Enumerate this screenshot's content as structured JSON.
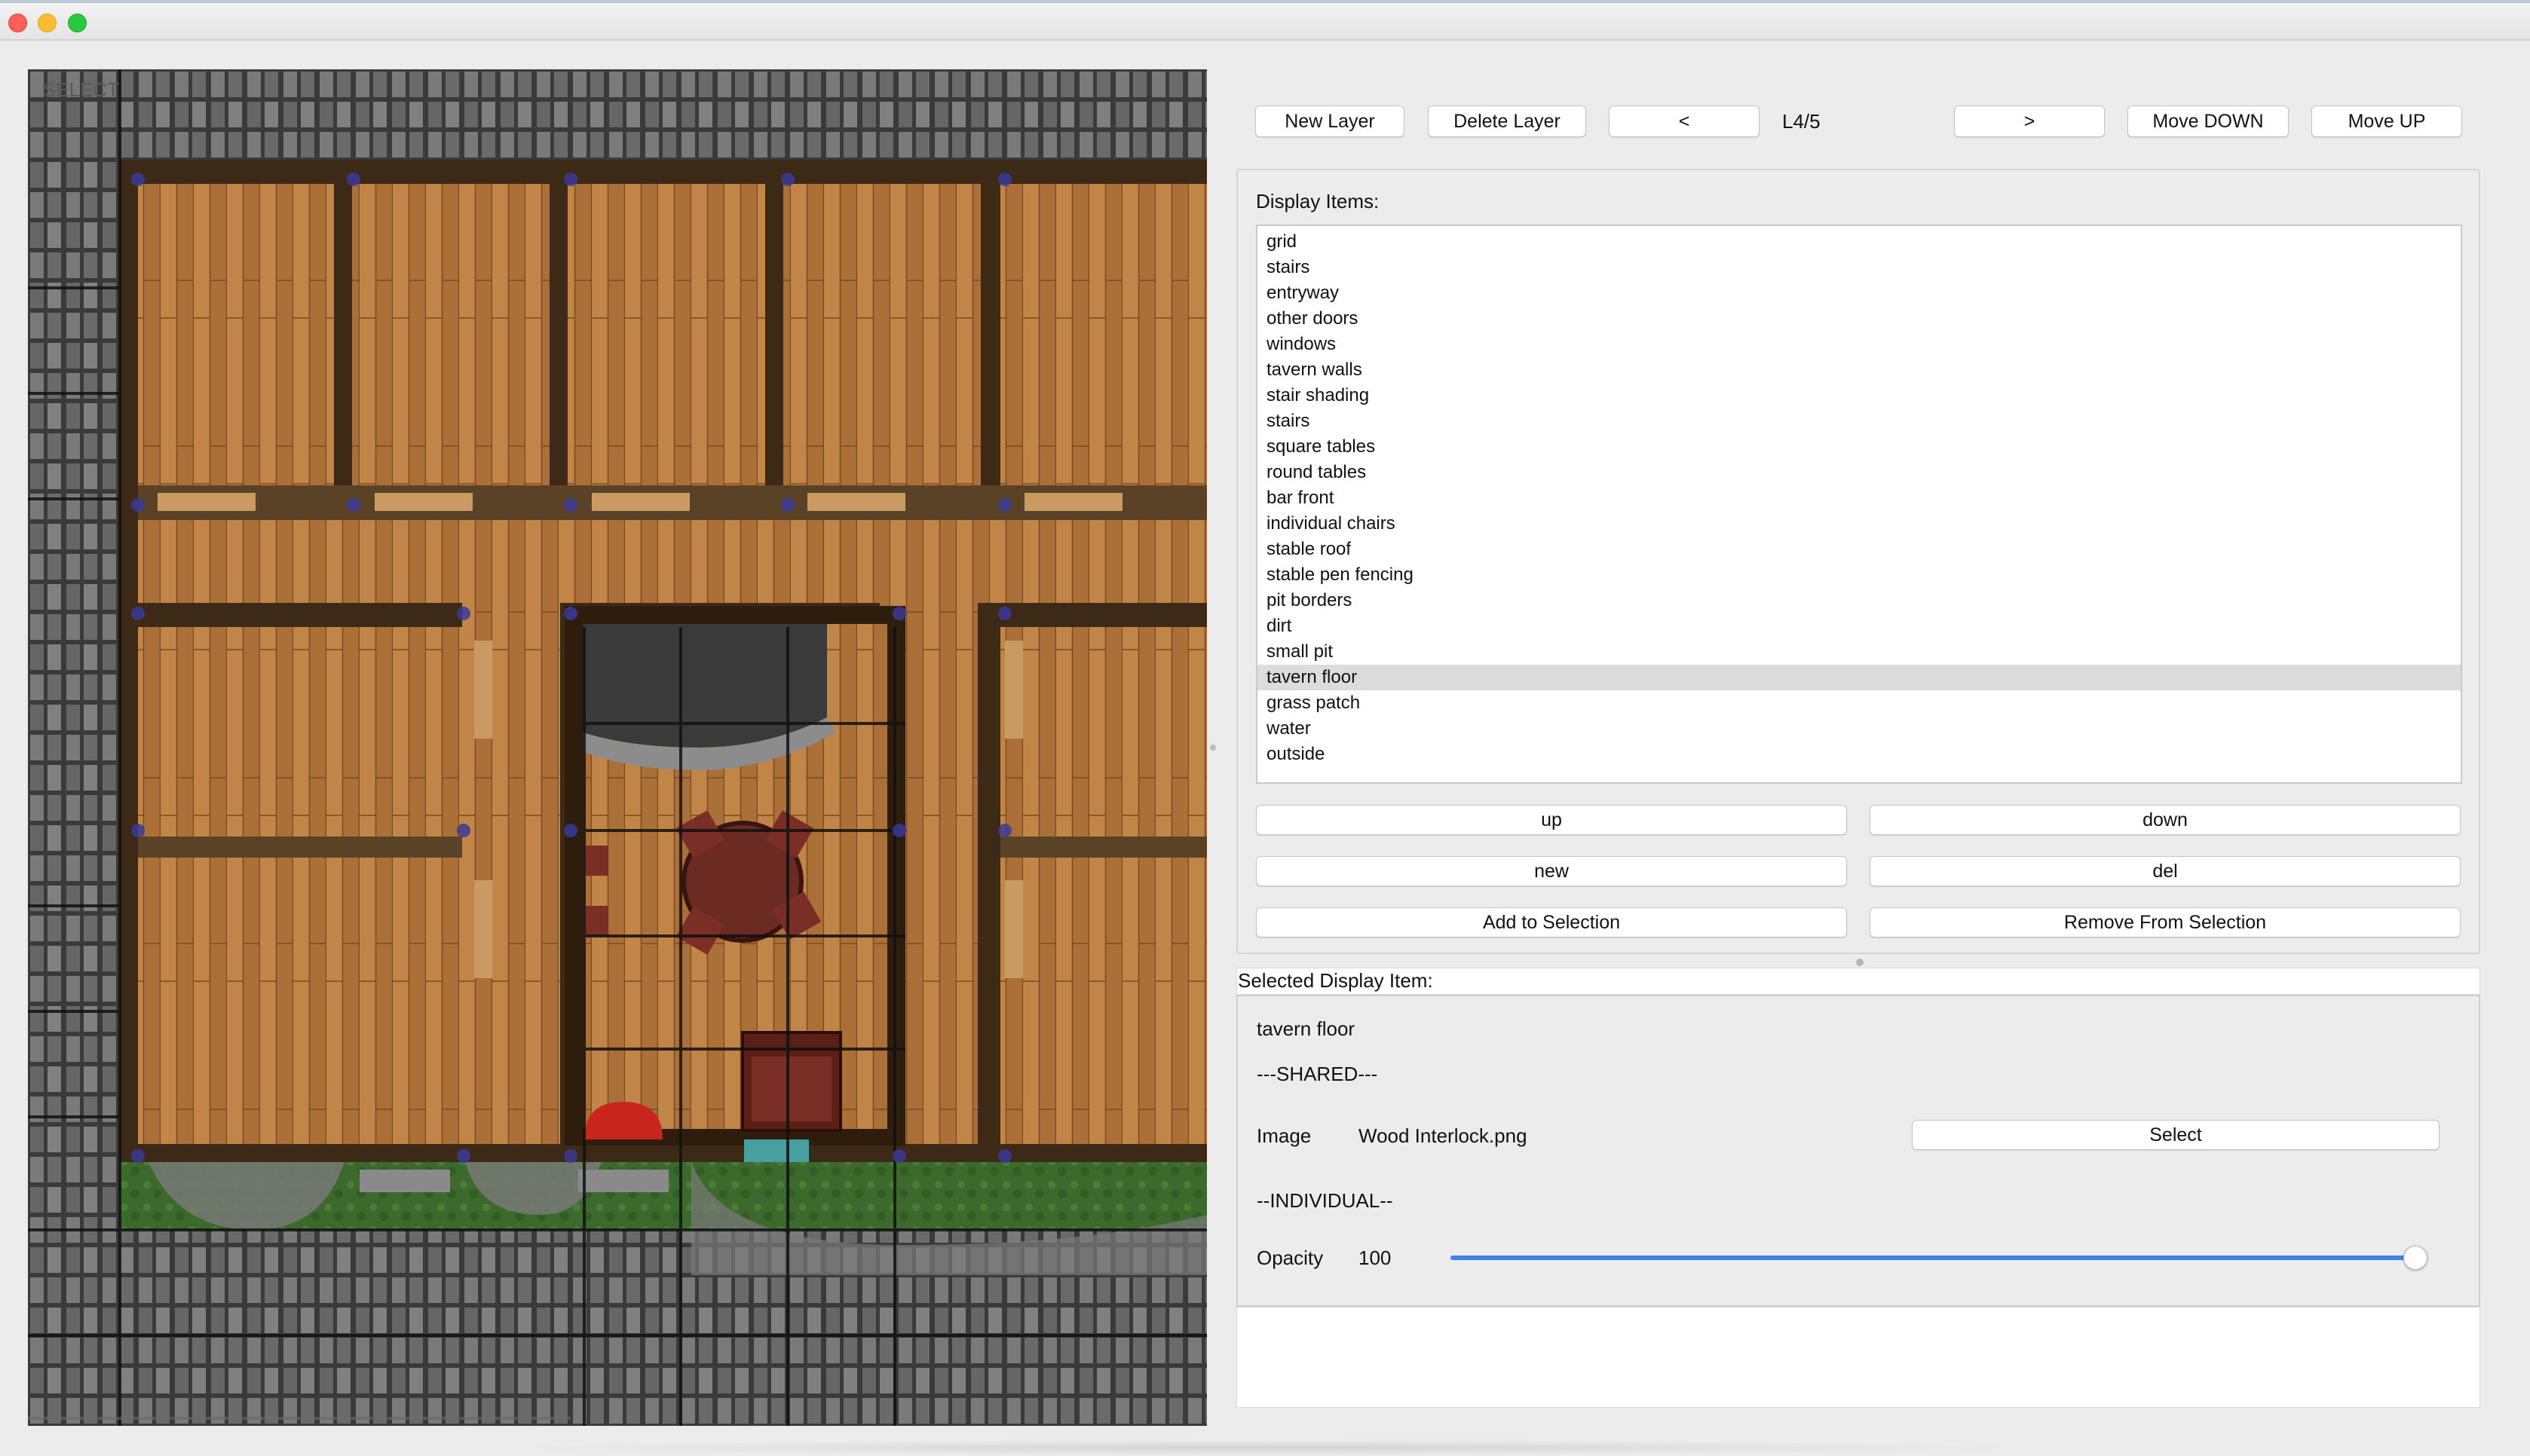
{
  "window": {
    "controls": [
      "close",
      "minimize",
      "zoom"
    ]
  },
  "map": {
    "overlay_text": "SELECT",
    "description_icons": [
      "stone-wall-tiles",
      "wood-floor-rooms",
      "round-table",
      "chairs",
      "grass-patch",
      "pit"
    ]
  },
  "toolbar": {
    "new_layer": "New Layer",
    "delete_layer": "Delete Layer",
    "prev": "<",
    "layer_indicator": "L4/5",
    "next": ">",
    "move_down": "Move DOWN",
    "move_up": "Move UP"
  },
  "display_items": {
    "title": "Display Items:",
    "items": [
      {
        "label": "grid"
      },
      {
        "label": "stairs"
      },
      {
        "label": "entryway"
      },
      {
        "label": "other doors"
      },
      {
        "label": "windows"
      },
      {
        "label": "tavern walls"
      },
      {
        "label": "stair shading"
      },
      {
        "label": "stairs"
      },
      {
        "label": "square tables"
      },
      {
        "label": "round tables"
      },
      {
        "label": "bar front"
      },
      {
        "label": "individual chairs"
      },
      {
        "label": "stable roof"
      },
      {
        "label": "stable pen fencing"
      },
      {
        "label": "pit borders"
      },
      {
        "label": "dirt"
      },
      {
        "label": "small pit"
      },
      {
        "label": "tavern floor",
        "selected": true
      },
      {
        "label": "grass patch"
      },
      {
        "label": "water"
      },
      {
        "label": "outside"
      }
    ],
    "selected_index": 17,
    "up": "up",
    "down": "down",
    "new": "new",
    "del": "del",
    "add_to_selection": "Add to Selection",
    "remove_from_selection": "Remove From Selection"
  },
  "selected_item": {
    "header": "Selected Display Item:",
    "name": "tavern floor",
    "shared_header": "---SHARED---",
    "image_label": "Image",
    "image_value": "Wood Interlock.png",
    "select_button": "Select",
    "individual_header": "--INDIVIDUAL--",
    "opacity_label": "Opacity",
    "opacity_value": "100",
    "opacity_fraction": 1.0
  },
  "colors": {
    "accent": "#3b82e8",
    "selected_row": "#dcdcdc",
    "grid_handle": "#3a3a9a"
  }
}
